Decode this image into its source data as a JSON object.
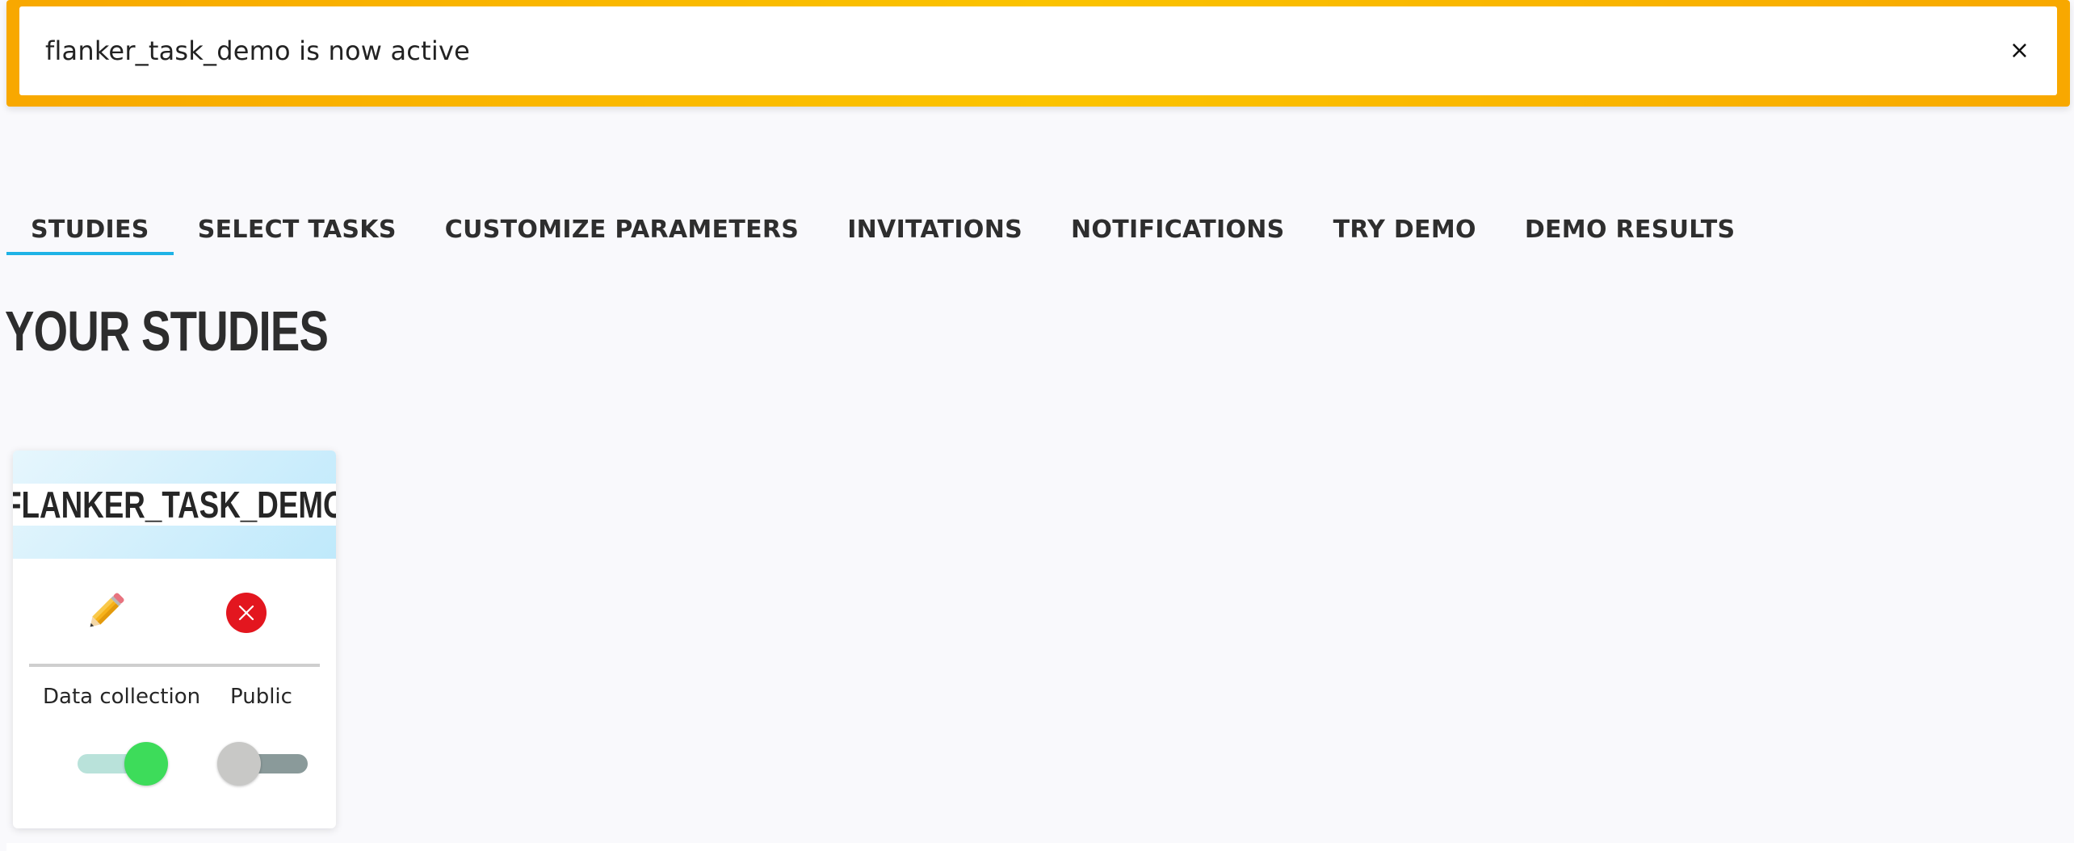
{
  "banner": {
    "message": "flanker_task_demo is now active",
    "close_label": "×"
  },
  "tabs": [
    {
      "label": "STUDIES",
      "active": true
    },
    {
      "label": "SELECT TASKS",
      "active": false
    },
    {
      "label": "CUSTOMIZE PARAMETERS",
      "active": false
    },
    {
      "label": "INVITATIONS",
      "active": false
    },
    {
      "label": "NOTIFICATIONS",
      "active": false
    },
    {
      "label": "TRY DEMO",
      "active": false
    },
    {
      "label": "DEMO RESULTS",
      "active": false
    }
  ],
  "heading": "YOUR STUDIES",
  "studies": [
    {
      "title": "FLANKER_TASK_DEMO",
      "actions": {
        "edit_icon": "pencil-icon",
        "delete_icon": "close-circle-icon"
      },
      "toggles": {
        "data_collection": {
          "label": "Data collection",
          "on": true
        },
        "public": {
          "label": "Public",
          "on": false
        }
      }
    }
  ],
  "colors": {
    "banner_accent": "#fbc300",
    "tab_underline": "#1fb3e6",
    "toggle_on": "#3ddc5a",
    "delete_red": "#e3161f"
  }
}
